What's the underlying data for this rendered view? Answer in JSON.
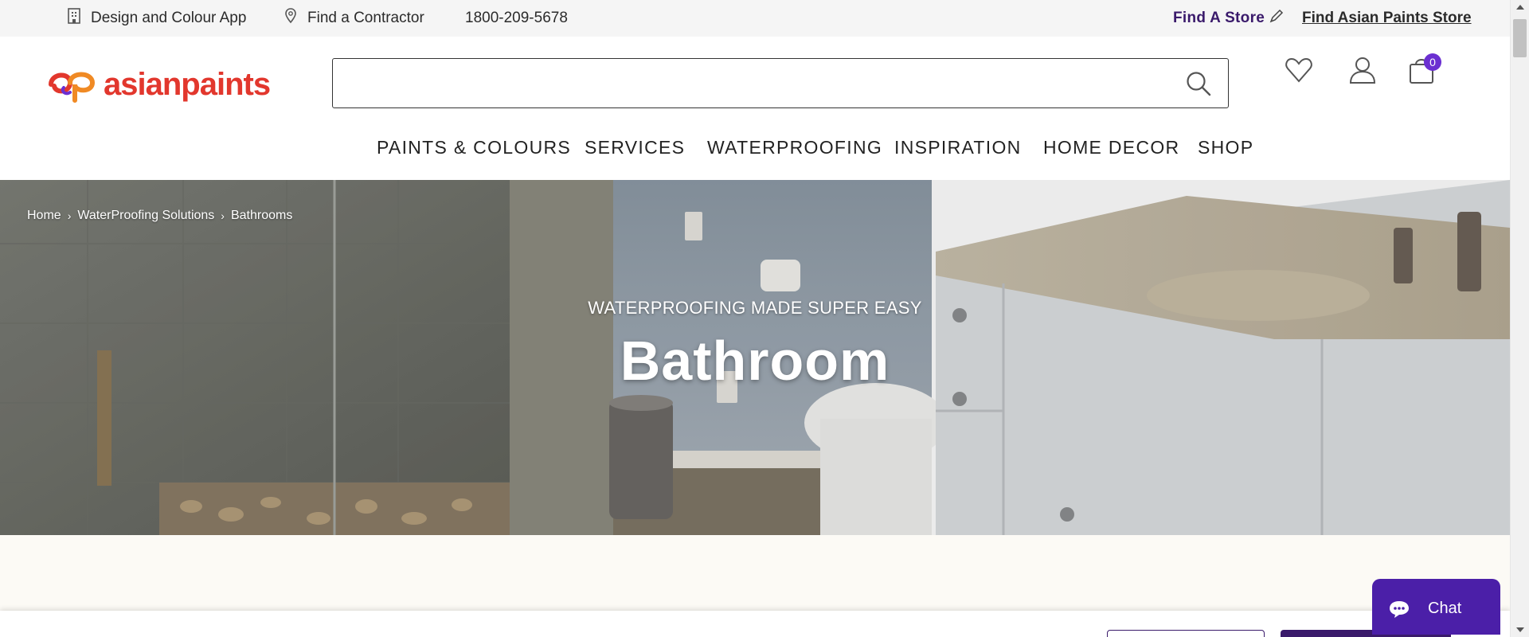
{
  "topbar": {
    "design_app": "Design and Colour App",
    "find_contractor": "Find a Contractor",
    "phone": "1800-209-5678",
    "find_store": "Find A Store",
    "find_asian_paints_store": "Find Asian Paints Store"
  },
  "header": {
    "logo_text": "asianpaints",
    "search_placeholder": "",
    "cart_count": "0"
  },
  "nav": {
    "items": [
      "PAINTS & COLOURS",
      "SERVICES",
      "WATERPROOFING",
      "INSPIRATION",
      "HOME DECOR",
      "SHOP"
    ]
  },
  "breadcrumb": {
    "items": [
      "Home",
      "WaterProofing Solutions",
      "Bathrooms"
    ],
    "separator": "›"
  },
  "hero": {
    "subtitle": "WATERPROOFING MADE SUPER EASY",
    "title": "Bathroom"
  },
  "chat": {
    "label": "Chat"
  },
  "colors": {
    "brand_red": "#e2372d",
    "brand_purple": "#3a1a6b",
    "chat_purple": "#4b1fa8",
    "badge_purple": "#6b2fd1"
  }
}
